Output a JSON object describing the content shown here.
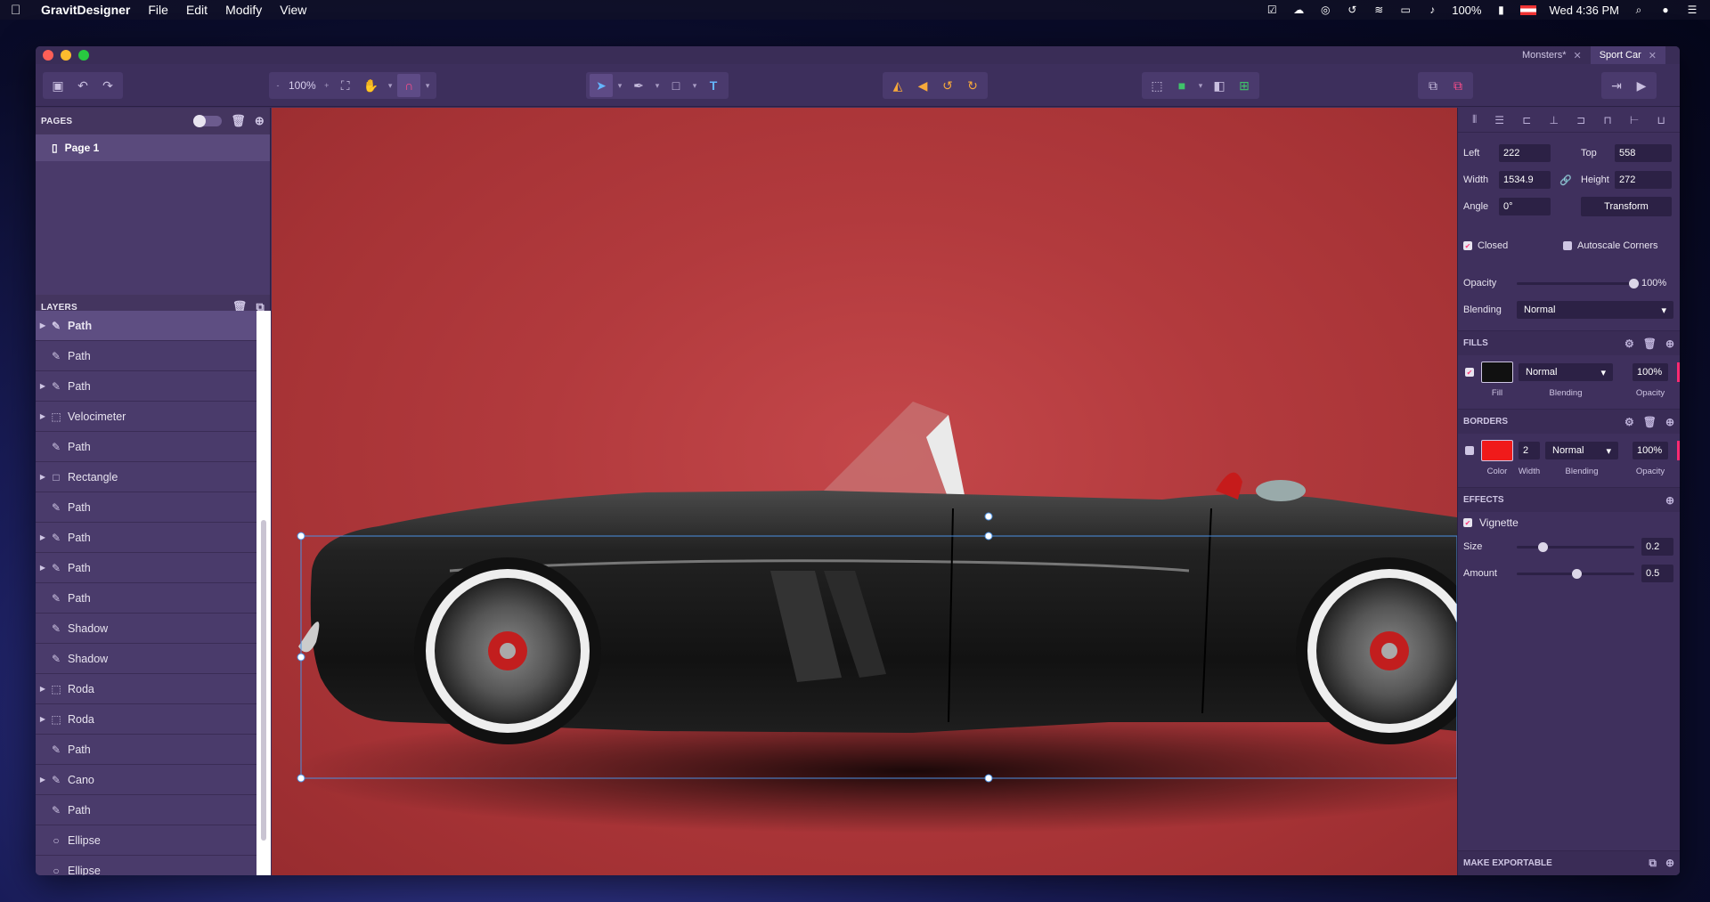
{
  "menubar": {
    "app_name": "GravitDesigner",
    "items": [
      "File",
      "Edit",
      "Modify",
      "View"
    ],
    "battery": "100%",
    "clock": "Wed 4:36 PM"
  },
  "tabs": [
    {
      "label": "Monsters*",
      "active": false
    },
    {
      "label": "Sport Car",
      "active": true
    }
  ],
  "toolbar": {
    "zoom": "100%",
    "zoom_minus": "-",
    "zoom_plus": "+"
  },
  "pages_panel": {
    "title": "PAGES",
    "pages": [
      "Page 1"
    ]
  },
  "layers_panel": {
    "title": "LAYERS",
    "layers": [
      {
        "name": "Path",
        "icon": "pen-icon",
        "expandable": true,
        "selected": true
      },
      {
        "name": "Path",
        "icon": "pen-icon",
        "expandable": false,
        "selected": false
      },
      {
        "name": "Path",
        "icon": "pen-icon",
        "expandable": true,
        "selected": false
      },
      {
        "name": "Velocimeter",
        "icon": "group-icon",
        "expandable": true,
        "selected": false
      },
      {
        "name": "Path",
        "icon": "pen-icon",
        "expandable": false,
        "selected": false
      },
      {
        "name": "Rectangle",
        "icon": "rectangle-icon",
        "expandable": true,
        "selected": false
      },
      {
        "name": "Path",
        "icon": "pen-icon",
        "expandable": false,
        "selected": false
      },
      {
        "name": "Path",
        "icon": "pen-icon",
        "expandable": true,
        "selected": false
      },
      {
        "name": "Path",
        "icon": "pen-icon",
        "expandable": true,
        "selected": false
      },
      {
        "name": "Path",
        "icon": "pen-icon",
        "expandable": false,
        "selected": false
      },
      {
        "name": "Shadow",
        "icon": "pen-icon",
        "expandable": false,
        "selected": false
      },
      {
        "name": "Shadow",
        "icon": "pen-icon",
        "expandable": false,
        "selected": false
      },
      {
        "name": "Roda",
        "icon": "group-icon",
        "expandable": true,
        "selected": false
      },
      {
        "name": "Roda",
        "icon": "group-icon",
        "expandable": true,
        "selected": false
      },
      {
        "name": "Path",
        "icon": "pen-icon",
        "expandable": false,
        "selected": false
      },
      {
        "name": "Cano",
        "icon": "pen-icon",
        "expandable": true,
        "selected": false
      },
      {
        "name": "Path",
        "icon": "pen-icon",
        "expandable": false,
        "selected": false
      },
      {
        "name": "Ellipse",
        "icon": "ellipse-icon",
        "expandable": false,
        "selected": false
      },
      {
        "name": "Ellipse",
        "icon": "ellipse-icon",
        "expandable": false,
        "selected": false
      }
    ]
  },
  "inspector": {
    "left_label": "Left",
    "left_value": "222",
    "top_label": "Top",
    "top_value": "558",
    "width_label": "Width",
    "width_value": "1534.9",
    "height_label": "Height",
    "height_value": "272",
    "angle_label": "Angle",
    "angle_value": "0°",
    "transform_label": "Transform",
    "closed_label": "Closed",
    "autoscale_label": "Autoscale Corners",
    "opacity_label": "Opacity",
    "opacity_value": "100%",
    "blending_label": "Blending",
    "blending_value": "Normal",
    "fills_title": "FILLS",
    "fill": {
      "color": "#111111",
      "blending": "Normal",
      "opacity": "100%",
      "fill_label": "Fill",
      "blending_label": "Blending",
      "opacity_label": "Opacity"
    },
    "borders_title": "BORDERS",
    "border": {
      "color": "#f01a1a",
      "width": "2",
      "blending": "Normal",
      "opacity": "100%",
      "color_label": "Color",
      "width_label": "Width",
      "blending_label": "Blending",
      "opacity_label": "Opacity"
    },
    "effects_title": "EFFECTS",
    "vignette_label": "Vignette",
    "size_label": "Size",
    "size_value": "0.2",
    "amount_label": "Amount",
    "amount_value": "0.5",
    "make_exportable": "MAKE EXPORTABLE"
  }
}
